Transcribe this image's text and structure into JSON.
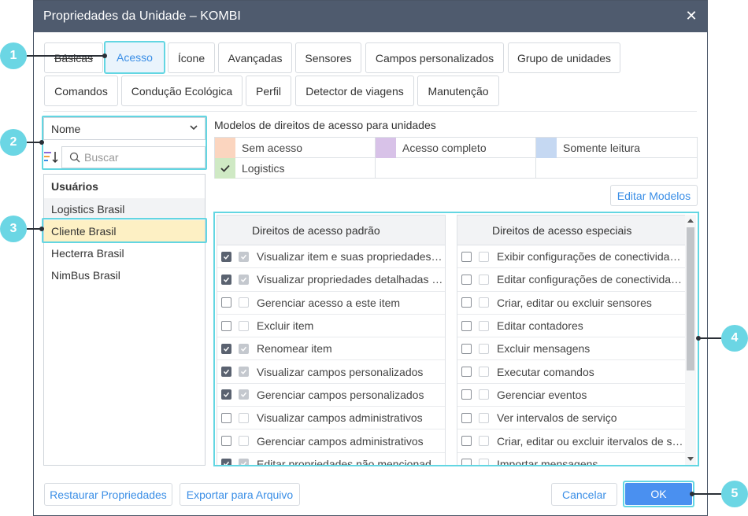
{
  "dialog": {
    "title": "Propriedades da Unidade – KOMBI",
    "close_glyph": "✕"
  },
  "tabs": [
    {
      "label": "Básicas"
    },
    {
      "label": "Acesso"
    },
    {
      "label": "Ícone"
    },
    {
      "label": "Avançadas"
    },
    {
      "label": "Sensores"
    },
    {
      "label": "Campos personalizados"
    },
    {
      "label": "Grupo de unidades"
    },
    {
      "label": "Comandos"
    },
    {
      "label": "Condução Ecológica"
    },
    {
      "label": "Perfil"
    },
    {
      "label": "Detector de viagens"
    },
    {
      "label": "Manutenção"
    }
  ],
  "left": {
    "sort_select": "Nome",
    "search_placeholder": "Buscar",
    "list_header": "Usuários",
    "users": [
      "Logistics Brasil",
      "Cliente Brasil",
      "Hecterra Brasil",
      "NimBus Brasil"
    ]
  },
  "models": {
    "title": "Modelos de direitos de acesso para unidades",
    "items": [
      {
        "label": "Sem acesso",
        "color": "#fbd5bf"
      },
      {
        "label": "Acesso completo",
        "color": "#d8c2e8"
      },
      {
        "label": "Somente leitura",
        "color": "#c5d8f2"
      },
      {
        "label": "Logistics",
        "color": "#cfe9c4"
      }
    ],
    "edit_button": "Editar Modelos"
  },
  "rights": {
    "standard_header": "Direitos de acesso padrão",
    "special_header": "Direitos de acesso especiais",
    "standard": [
      {
        "label": "Visualizar item e suas propriedades b…",
        "checked": true
      },
      {
        "label": "Visualizar propriedades detalhadas d…",
        "checked": true
      },
      {
        "label": "Gerenciar acesso a este item",
        "checked": false
      },
      {
        "label": "Excluir item",
        "checked": false
      },
      {
        "label": "Renomear item",
        "checked": true
      },
      {
        "label": "Visualizar campos personalizados",
        "checked": true
      },
      {
        "label": "Gerenciar campos personalizados",
        "checked": true
      },
      {
        "label": "Visualizar campos administrativos",
        "checked": false
      },
      {
        "label": "Gerenciar campos administrativos",
        "checked": false
      },
      {
        "label": "Editar propriedades não mencionada…",
        "checked": true
      }
    ],
    "special": [
      {
        "label": "Exibir configurações de conectividade…",
        "checked": false
      },
      {
        "label": "Editar configurações de conectividade…",
        "checked": false
      },
      {
        "label": "Criar, editar ou excluir sensores",
        "checked": false
      },
      {
        "label": "Editar contadores",
        "checked": false
      },
      {
        "label": "Excluir mensagens",
        "checked": false
      },
      {
        "label": "Executar comandos",
        "checked": false
      },
      {
        "label": "Gerenciar eventos",
        "checked": false
      },
      {
        "label": "Ver intervalos de serviço",
        "checked": false
      },
      {
        "label": "Criar, editar ou excluir itervalos de ser…",
        "checked": false
      },
      {
        "label": "Importar mensagens",
        "checked": false
      }
    ]
  },
  "footer": {
    "restore": "Restaurar Propriedades",
    "export": "Exportar para Arquivo",
    "cancel": "Cancelar",
    "ok": "OK"
  },
  "callouts": [
    "1",
    "2",
    "3",
    "4",
    "5"
  ],
  "colors": {
    "titlebar": "#4f5b6e",
    "accent": "#3a8ee6",
    "highlight": "#63d6e2",
    "ok_button": "#4a90f0"
  }
}
